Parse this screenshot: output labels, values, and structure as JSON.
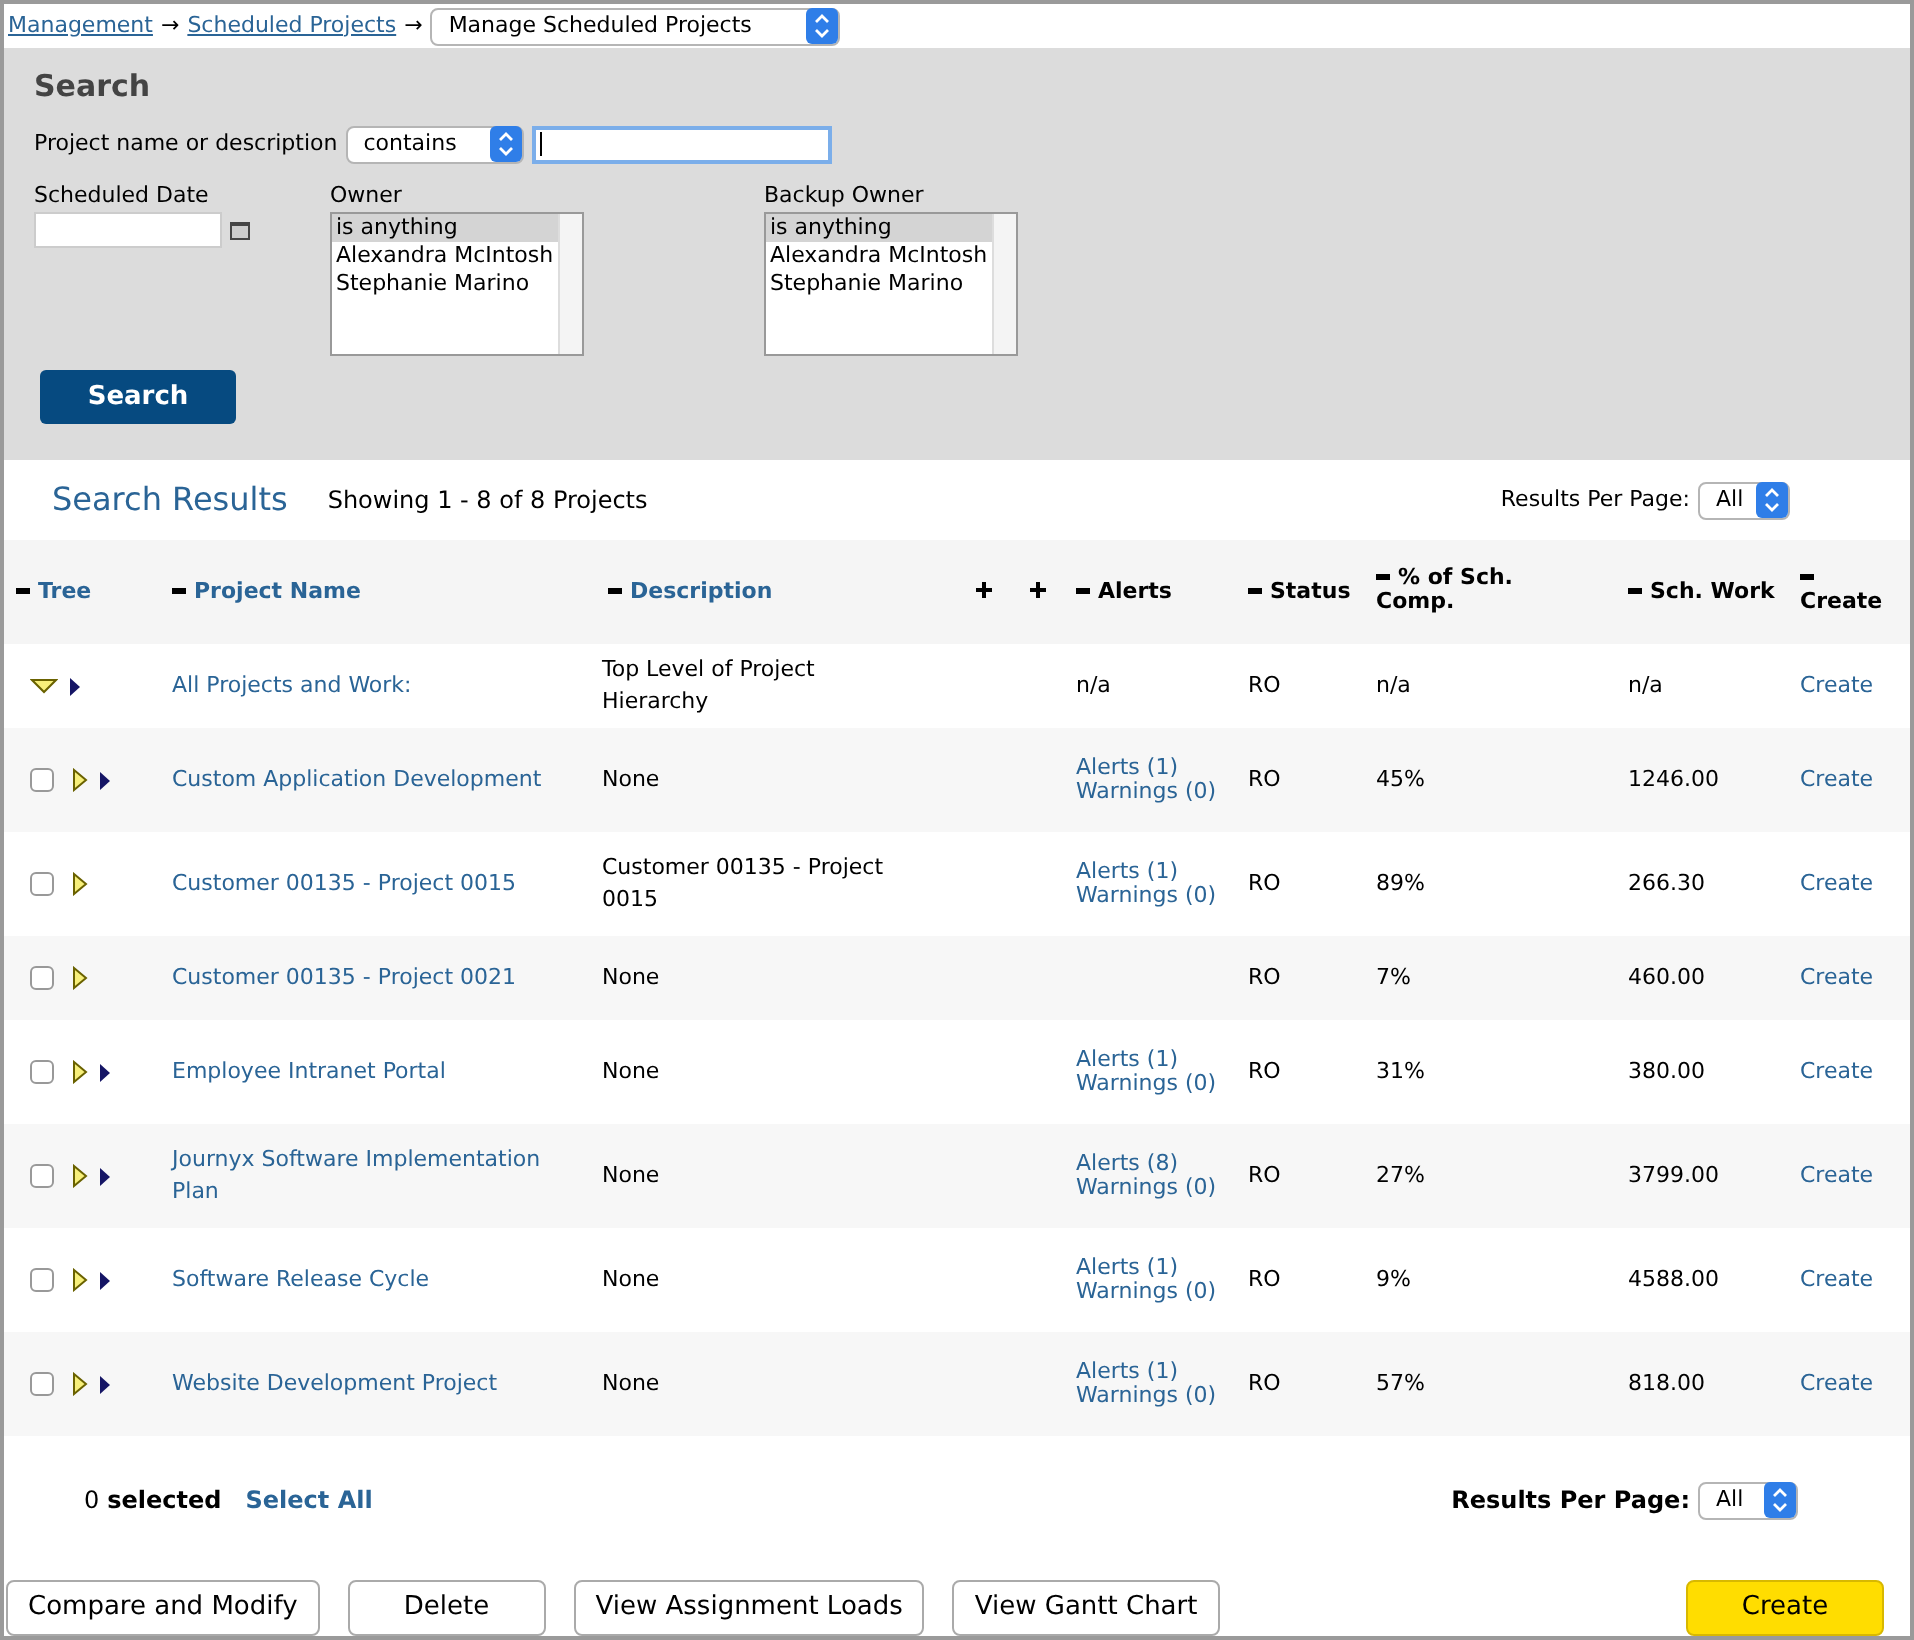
{
  "breadcrumb": {
    "links": [
      "Management",
      "Scheduled Projects"
    ],
    "separator": "→",
    "current": "Manage Scheduled Projects"
  },
  "search": {
    "title": "Search",
    "name_label": "Project name or description",
    "match_select": "contains",
    "date_label": "Scheduled Date",
    "owner": {
      "label": "Owner",
      "options": [
        {
          "label": "is anything",
          "selected": true
        },
        {
          "label": "Alexandra McIntosh",
          "selected": false
        },
        {
          "label": "Stephanie Marino",
          "selected": false
        }
      ]
    },
    "backup_owner": {
      "label": "Backup Owner",
      "options": [
        {
          "label": "is anything",
          "selected": true
        },
        {
          "label": "Alexandra McIntosh",
          "selected": false
        },
        {
          "label": "Stephanie Marino",
          "selected": false
        }
      ]
    },
    "button": "Search"
  },
  "results": {
    "title": "Search Results",
    "showing": "Showing 1 - 8 of 8 Projects",
    "per_page_label": "Results Per Page:",
    "per_page": "All"
  },
  "table": {
    "columns": [
      {
        "label": "Tree",
        "kind": "sortable"
      },
      {
        "label": "Project Name",
        "kind": "sortable"
      },
      {
        "label": "Description",
        "kind": "sortable"
      },
      {
        "label": "Alerts",
        "kind": "plain"
      },
      {
        "label": "Status",
        "kind": "plain"
      },
      {
        "label": "% of Sch. Comp.",
        "kind": "plain"
      },
      {
        "label": "Sch. Work",
        "kind": "plain"
      },
      {
        "label": "Create",
        "kind": "plain"
      }
    ],
    "rows": [
      {
        "kind": "root",
        "expanded": true,
        "sub_arrow": true,
        "name": "All Projects and Work:",
        "description": "Top Level of Project Hierarchy",
        "alerts": [
          "n/a"
        ],
        "status": "RO",
        "comp": "n/a",
        "work": "n/a",
        "create": "Create"
      },
      {
        "kind": "project",
        "checked": false,
        "expanded": false,
        "sub_arrow": true,
        "name": "Custom Application Development",
        "description": "None",
        "alerts": [
          "Alerts (1)",
          "Warnings (0)"
        ],
        "status": "RO",
        "comp": "45%",
        "work": "1246.00",
        "create": "Create"
      },
      {
        "kind": "project",
        "checked": false,
        "expanded": false,
        "sub_arrow": false,
        "name": "Customer 00135 - Project 0015",
        "description": "Customer 00135 - Project 0015",
        "alerts": [
          "Alerts (1)",
          "Warnings (0)"
        ],
        "status": "RO",
        "comp": "89%",
        "work": "266.30",
        "create": "Create"
      },
      {
        "kind": "project",
        "checked": false,
        "expanded": false,
        "sub_arrow": false,
        "name": "Customer 00135 - Project 0021",
        "description": "None",
        "alerts": [],
        "status": "RO",
        "comp": "7%",
        "work": "460.00",
        "create": "Create"
      },
      {
        "kind": "project",
        "checked": false,
        "expanded": false,
        "sub_arrow": true,
        "name": "Employee Intranet Portal",
        "description": "None",
        "alerts": [
          "Alerts (1)",
          "Warnings (0)"
        ],
        "status": "RO",
        "comp": "31%",
        "work": "380.00",
        "create": "Create"
      },
      {
        "kind": "project",
        "checked": false,
        "expanded": false,
        "sub_arrow": true,
        "name": "Journyx Software Implementation Plan",
        "description": "None",
        "alerts": [
          "Alerts (8)",
          "Warnings (0)"
        ],
        "status": "RO",
        "comp": "27%",
        "work": "3799.00",
        "create": "Create"
      },
      {
        "kind": "project",
        "checked": false,
        "expanded": false,
        "sub_arrow": true,
        "name": "Software Release Cycle",
        "description": "None",
        "alerts": [
          "Alerts (1)",
          "Warnings (0)"
        ],
        "status": "RO",
        "comp": "9%",
        "work": "4588.00",
        "create": "Create"
      },
      {
        "kind": "project",
        "checked": false,
        "expanded": false,
        "sub_arrow": true,
        "name": "Website Development Project",
        "description": "None",
        "alerts": [
          "Alerts (1)",
          "Warnings (0)"
        ],
        "status": "RO",
        "comp": "57%",
        "work": "818.00",
        "create": "Create"
      }
    ]
  },
  "footer": {
    "selected_count": "0",
    "selected_label": "selected",
    "select_all": "Select All",
    "per_page_label": "Results Per Page:",
    "per_page": "All"
  },
  "actions": [
    {
      "label": "Compare and Modify",
      "kind": "plain"
    },
    {
      "label": "Delete",
      "kind": "plain"
    },
    {
      "label": "View Assignment Loads",
      "kind": "plain"
    },
    {
      "label": "View Gantt Chart",
      "kind": "plain"
    },
    {
      "label": "Create",
      "kind": "primary"
    }
  ]
}
